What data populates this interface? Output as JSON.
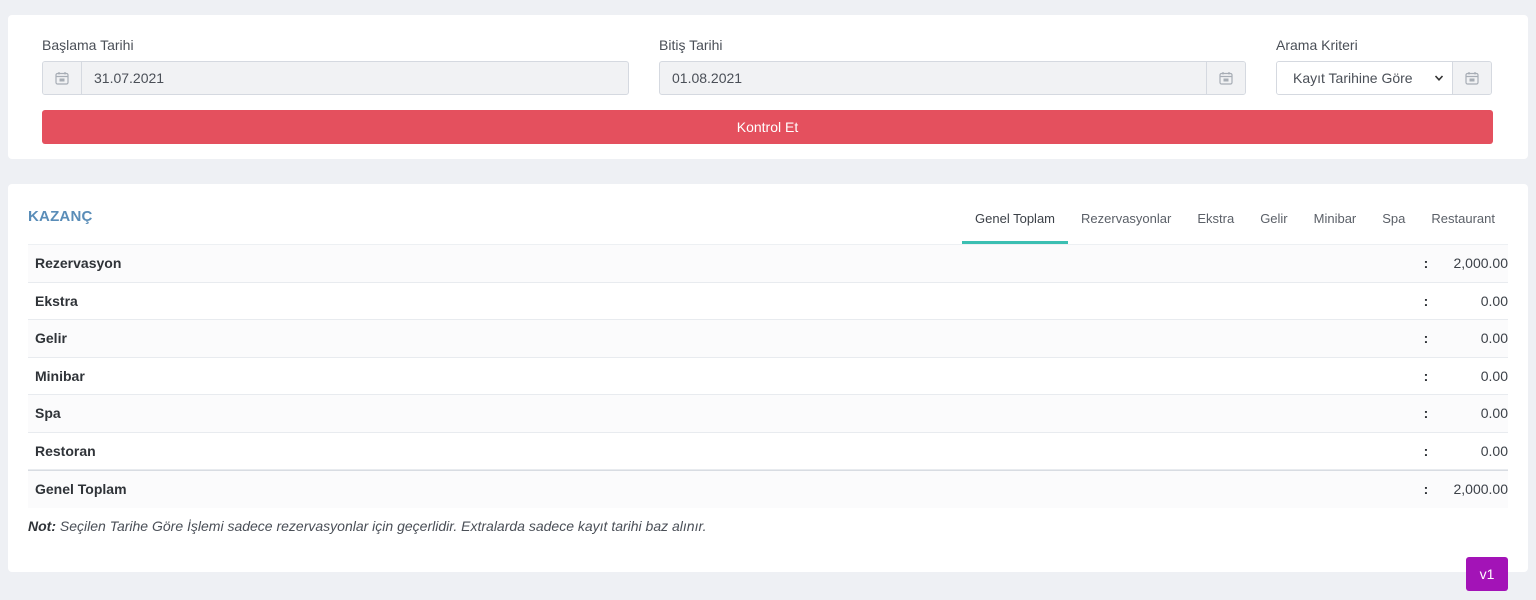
{
  "filters": {
    "start": {
      "label": "Başlama Tarihi",
      "value": "31.07.2021"
    },
    "end": {
      "label": "Bitiş Tarihi",
      "value": "01.08.2021"
    },
    "criteria": {
      "label": "Arama Kriteri",
      "selected": "Kayıt Tarihine Göre"
    },
    "submit_label": "Kontrol Et"
  },
  "earnings": {
    "title": "KAZANÇ",
    "tabs": [
      {
        "label": "Genel Toplam",
        "active": true
      },
      {
        "label": "Rezervasyonlar"
      },
      {
        "label": "Ekstra"
      },
      {
        "label": "Gelir"
      },
      {
        "label": "Minibar"
      },
      {
        "label": "Spa"
      },
      {
        "label": "Restaurant"
      }
    ],
    "rows": [
      {
        "label": "Rezervasyon",
        "sep": ":",
        "value": "2,000.00"
      },
      {
        "label": "Ekstra",
        "sep": ":",
        "value": "0.00"
      },
      {
        "label": "Gelir",
        "sep": ":",
        "value": "0.00"
      },
      {
        "label": "Minibar",
        "sep": ":",
        "value": "0.00"
      },
      {
        "label": "Spa",
        "sep": ":",
        "value": "0.00"
      },
      {
        "label": "Restoran",
        "sep": ":",
        "value": "0.00"
      }
    ],
    "total": {
      "label": "Genel Toplam",
      "sep": ":",
      "value": "2,000.00"
    },
    "note_prefix": "Not:",
    "note_text": " Seçilen Tarihe Göre İşlemi sadece rezervasyonlar için geçerlidir. Extralarda sadece kayıt tarihi baz alınır."
  },
  "version_label": "v1",
  "icons": {
    "calendar": "calendar-icon",
    "dropdown": "chevron-down-icon"
  },
  "colors": {
    "danger": "#e4505e",
    "accent_tab": "#3bbfb2",
    "title": "#5a8db8",
    "badge": "#a313b7"
  }
}
